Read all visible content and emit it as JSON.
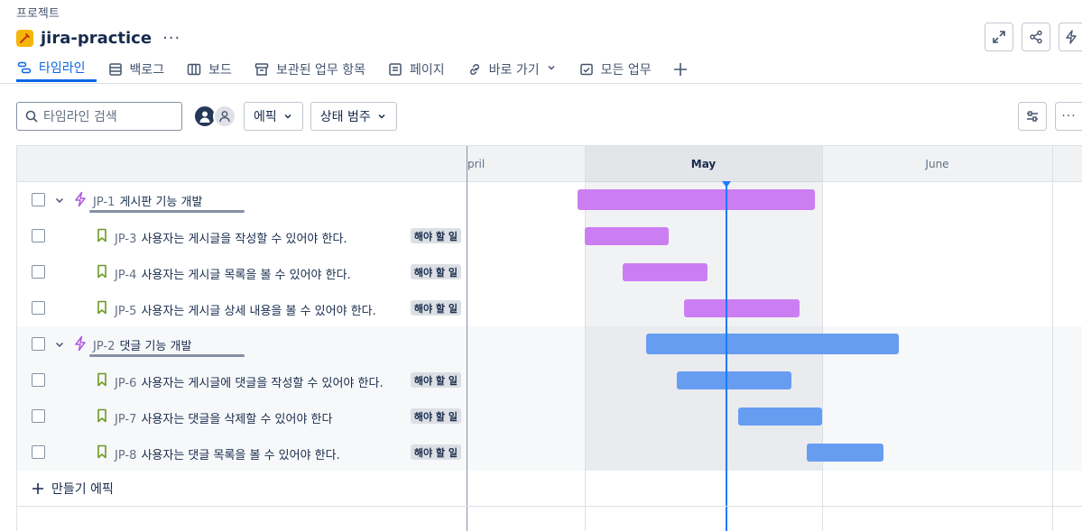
{
  "breadcrumb": "프로젝트",
  "project": {
    "name": "jira-practice",
    "more_label": "···"
  },
  "tabs": [
    {
      "label": "타임라인",
      "icon": "timeline-icon",
      "active": true
    },
    {
      "label": "백로그",
      "icon": "backlog-icon",
      "active": false
    },
    {
      "label": "보드",
      "icon": "board-icon",
      "active": false
    },
    {
      "label": "보관된 업무 항목",
      "icon": "archive-icon",
      "active": false
    },
    {
      "label": "페이지",
      "icon": "page-icon",
      "active": false
    },
    {
      "label": "바로 가기",
      "icon": "link-icon",
      "active": false
    },
    {
      "label": "모든 업무",
      "icon": "all-work-icon",
      "active": false
    }
  ],
  "toolbar": {
    "search_placeholder": "타임라인 검색",
    "epic_filter": "에픽",
    "status_filter": "상태 범주"
  },
  "timeline": {
    "months": [
      "pril",
      "May",
      "June"
    ],
    "current_month": "May"
  },
  "issues": [
    {
      "type": "epic",
      "key": "JP-1",
      "summary": "게시판 기능 개발",
      "color": "#cb7ef2",
      "start": "2025-04-30",
      "end": "2025-05-31",
      "shaded": false
    },
    {
      "type": "story",
      "key": "JP-3",
      "summary": "사용자는 게시글을 작성할 수 있어야 한다.",
      "status": "해야 할 일",
      "color": "#cb7ef2",
      "start": "2025-05-01",
      "end": "2025-05-12",
      "shaded": false
    },
    {
      "type": "story",
      "key": "JP-4",
      "summary": "사용자는 게시글 목록을 볼 수 있어야 한다.",
      "status": "해야 할 일",
      "color": "#cb7ef2",
      "start": "2025-05-06",
      "end": "2025-05-17",
      "shaded": false
    },
    {
      "type": "story",
      "key": "JP-5",
      "summary": "사용자는 게시글 상세 내용을 볼 수 있어야 한다.",
      "status": "해야 할 일",
      "color": "#cb7ef2",
      "start": "2025-05-14",
      "end": "2025-05-29",
      "shaded": false
    },
    {
      "type": "epic",
      "key": "JP-2",
      "summary": "댓글 기능 개발",
      "color": "#669df1",
      "start": "2025-05-09",
      "end": "2025-06-11",
      "shaded": true
    },
    {
      "type": "story",
      "key": "JP-6",
      "summary": "사용자는 게시글에 댓글을 작성할 수 있어야 한다.",
      "status": "해야 할 일",
      "color": "#669df1",
      "start": "2025-05-13",
      "end": "2025-05-28",
      "shaded": true
    },
    {
      "type": "story",
      "key": "JP-7",
      "summary": "사용자는 댓글을 삭제할 수 있어야 한다",
      "status": "해야 할 일",
      "color": "#669df1",
      "start": "2025-05-21",
      "end": "2025-06-01",
      "shaded": true
    },
    {
      "type": "story",
      "key": "JP-8",
      "summary": "사용자는 댓글 목록을 볼 수 있어야 한다.",
      "status": "해야 할 일",
      "color": "#669df1",
      "start": "2025-05-30",
      "end": "2025-06-09",
      "shaded": true
    }
  ],
  "create_epic_label": "만들기 에픽",
  "colors": {
    "accent": "#0c66e4",
    "today": "#1d7afc",
    "epic_board": "#cb7ef2",
    "epic_comment": "#669df1",
    "story_icon": "#6a9a23"
  }
}
